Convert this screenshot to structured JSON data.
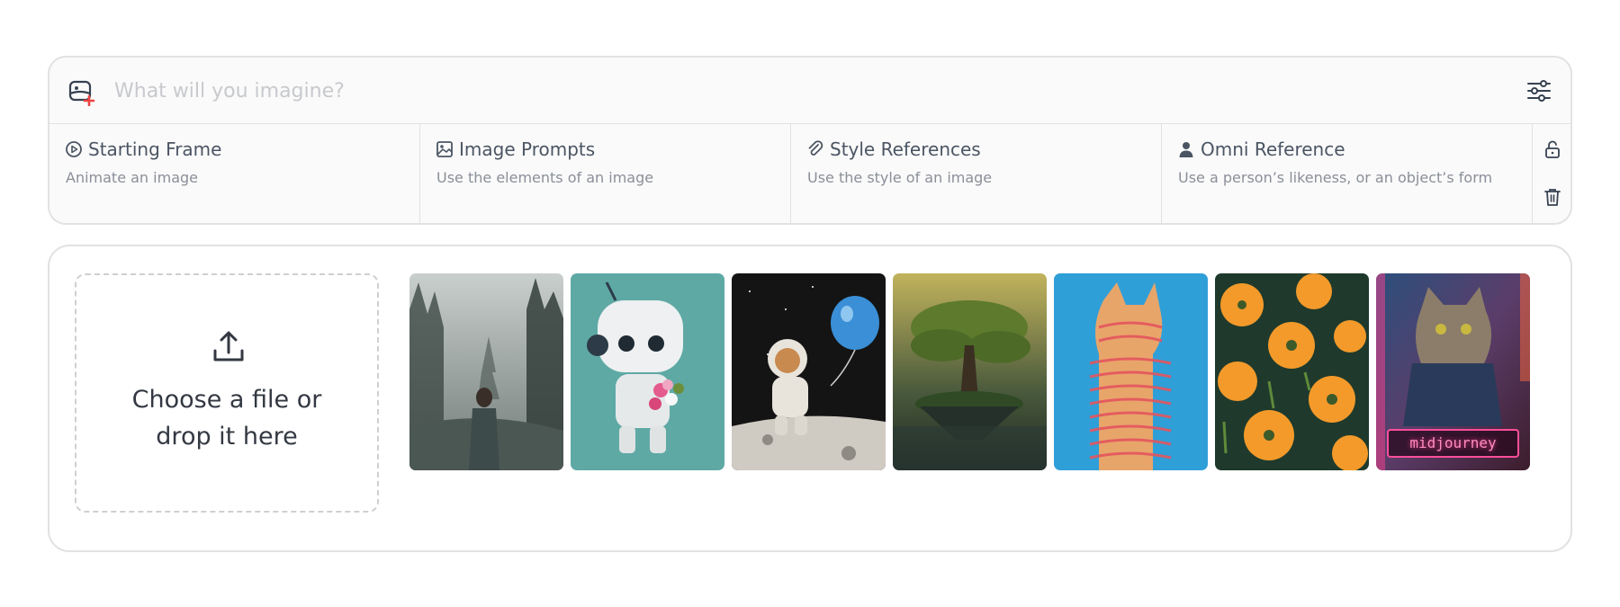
{
  "prompt": {
    "placeholder": "What will you imagine?"
  },
  "references": [
    {
      "title": "Starting Frame",
      "subtitle": "Animate an image",
      "icon": "play-circle-icon"
    },
    {
      "title": "Image Prompts",
      "subtitle": "Use the elements of an image",
      "icon": "image-icon"
    },
    {
      "title": "Style References",
      "subtitle": "Use the style of an image",
      "icon": "paperclip-icon"
    },
    {
      "title": "Omni Reference",
      "subtitle": "Use a person’s likeness, or an object’s form",
      "icon": "person-icon"
    }
  ],
  "upload": {
    "label": "Choose a file or\ndrop it here"
  },
  "gallery": [
    {
      "name": "woman-in-misty-forest"
    },
    {
      "name": "robot-with-flowers"
    },
    {
      "name": "cat-astronaut-balloon"
    },
    {
      "name": "tree-on-floating-island"
    },
    {
      "name": "striped-cat-on-blue"
    },
    {
      "name": "orange-poppies"
    },
    {
      "name": "neon-cat",
      "sign_text": "midjourney"
    }
  ],
  "colors": {
    "accent": "#ef4444",
    "border": "#e2e2e2",
    "neon_pink": "#ff4f9a"
  }
}
